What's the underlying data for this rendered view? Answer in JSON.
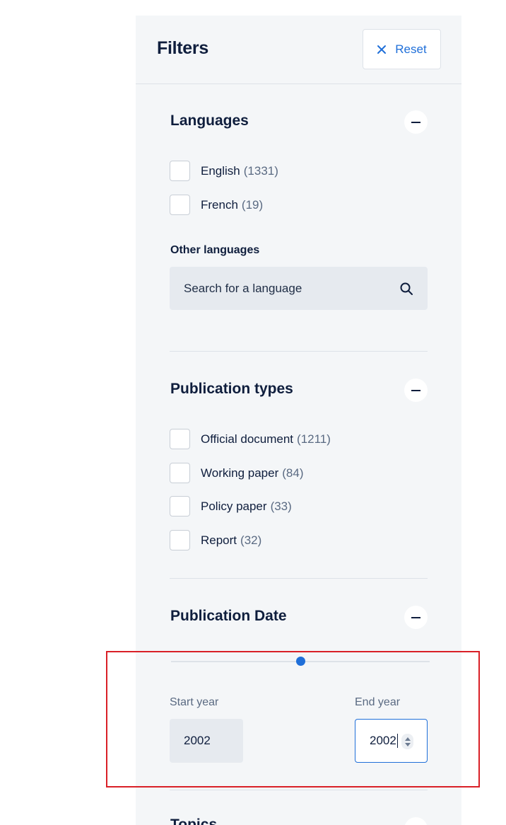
{
  "filters": {
    "title": "Filters",
    "reset_label": "Reset"
  },
  "languages": {
    "title": "Languages",
    "options": [
      {
        "label": "English",
        "count": "(1331)"
      },
      {
        "label": "French",
        "count": "(19)"
      }
    ],
    "other_title": "Other languages",
    "search_placeholder": "Search for a language"
  },
  "publication_types": {
    "title": "Publication types",
    "options": [
      {
        "label": "Official document",
        "count": "(1211)"
      },
      {
        "label": "Working paper",
        "count": "(84)"
      },
      {
        "label": "Policy paper",
        "count": "(33)"
      },
      {
        "label": "Report",
        "count": "(32)"
      }
    ]
  },
  "publication_date": {
    "title": "Publication Date",
    "slider_position": 0.5,
    "start_label": "Start year",
    "start_value": "2002",
    "end_label": "End year",
    "end_value": "2002"
  },
  "next_section": {
    "title": "Topics"
  },
  "colors": {
    "accent": "#1f6fd9",
    "text": "#0f1e3d",
    "muted": "#5a6a82",
    "panel_bg": "#f4f6f8",
    "highlight": "#d92027"
  }
}
